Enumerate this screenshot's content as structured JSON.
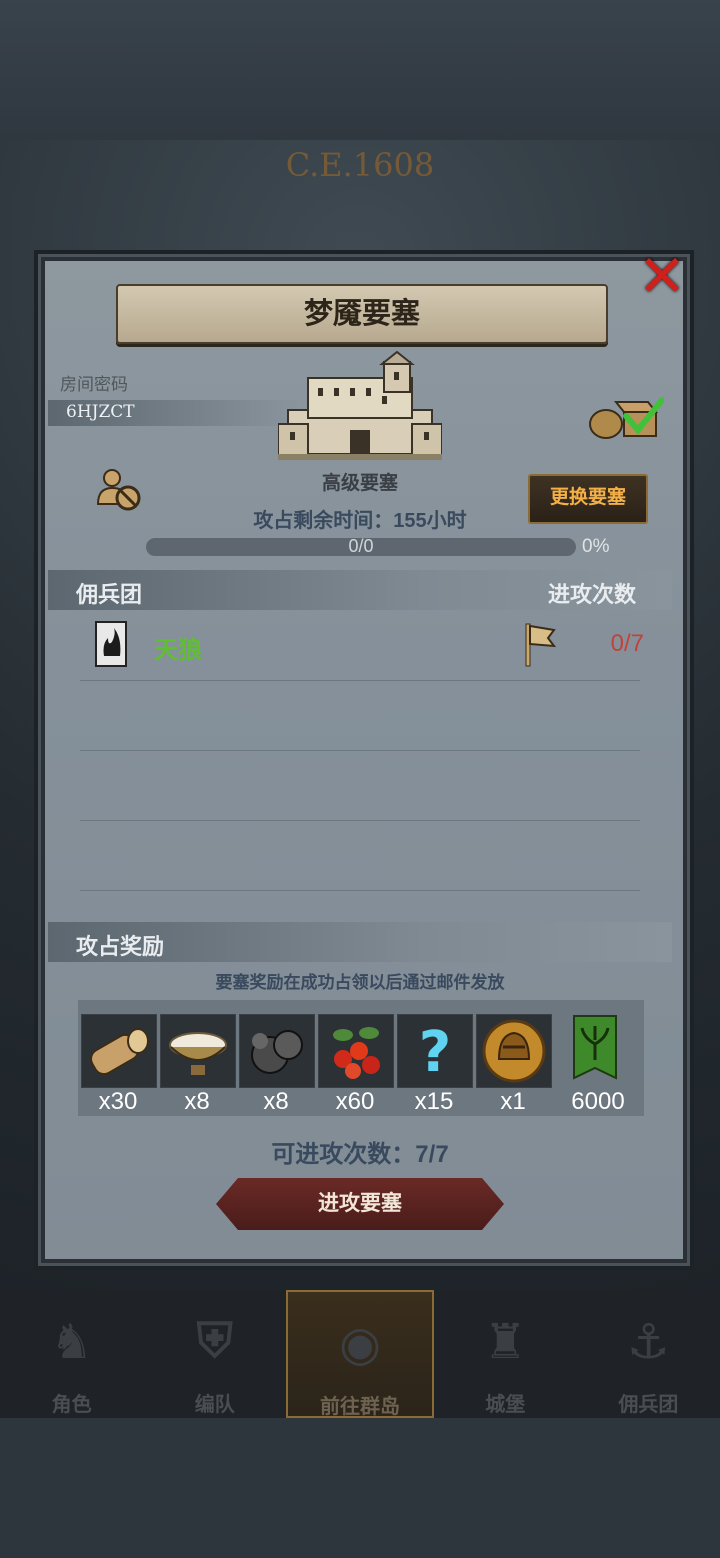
{
  "world": {
    "era": "C.E.1608"
  },
  "nav": [
    {
      "label": "角色",
      "icon": "knight-helmet-icon"
    },
    {
      "label": "编队",
      "icon": "armor-icon"
    },
    {
      "label": "前往群岛",
      "icon": "compass-map-icon",
      "active": true
    },
    {
      "label": "城堡",
      "icon": "castle-icon"
    },
    {
      "label": "佣兵团",
      "icon": "mercenary-ship-icon"
    }
  ],
  "panel": {
    "title": "梦魇要塞",
    "room_label": "房间密码",
    "room_code": "6HJZCT",
    "fortress_type": "高级要塞",
    "change_button": "更换要塞",
    "timer": "攻占剩余时间：155小时",
    "progress": {
      "text": "0/0",
      "percent": "0%",
      "fraction": 0
    },
    "mercenary_header": "佣兵团",
    "attack_count_header": "进攻次数",
    "mercenaries": [
      {
        "name": "天狼",
        "count": "0/7",
        "icon": "wolf-banner-icon"
      }
    ],
    "rewards_header": "攻占奖励",
    "rewards_note": "要塞奖励在成功占领以后通过邮件发放",
    "rewards": [
      {
        "name": "wood-log-icon",
        "qty": "x30"
      },
      {
        "name": "milk-bowl-icon",
        "qty": "x8"
      },
      {
        "name": "ore-icon",
        "qty": "x8"
      },
      {
        "name": "berries-icon",
        "qty": "x60"
      },
      {
        "name": "mystery-question-icon",
        "qty": "x15"
      },
      {
        "name": "golden-helmet-coin-icon",
        "qty": "x1"
      },
      {
        "name": "guild-banner-icon",
        "qty": "6000"
      }
    ],
    "attempts": "可进攻次数：7/7",
    "attack_button": "进攻要塞"
  },
  "colors": {
    "panel": "#85909a",
    "accent_gold": "#f4b046",
    "merc_green": "#5fbe32",
    "count_red": "#c2423a",
    "close_red": "#d0201c"
  }
}
